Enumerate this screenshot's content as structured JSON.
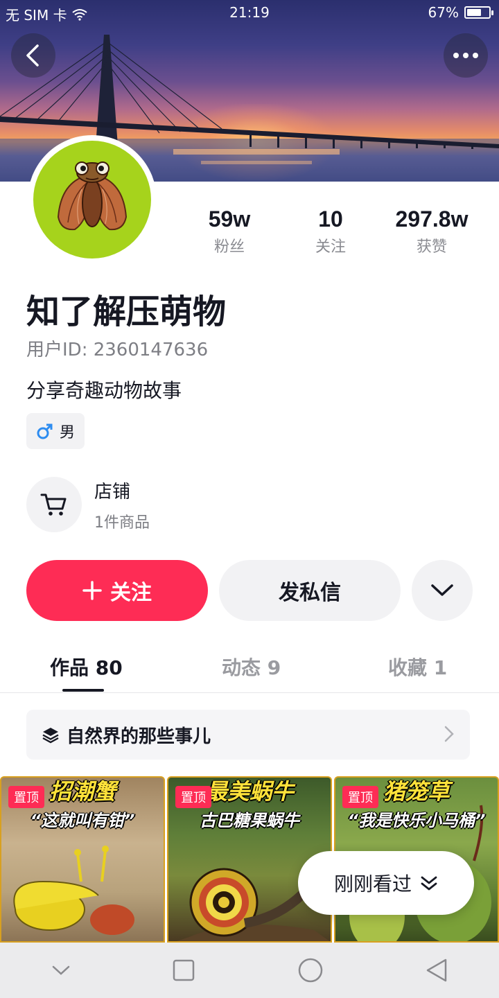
{
  "status_bar": {
    "carrier": "无 SIM 卡",
    "time": "21:19",
    "battery": "67%",
    "battery_level": 0.67
  },
  "header": {
    "back_icon": "chevron-left-icon",
    "more_icon": "more-dots-icon"
  },
  "profile": {
    "name": "知了解压萌物",
    "user_id": "用户ID: 2360147636",
    "bio": "分享奇趣动物故事",
    "gender": "男",
    "gender_icon": "male-icon"
  },
  "stats": [
    {
      "value": "59w",
      "label": "粉丝"
    },
    {
      "value": "10",
      "label": "关注"
    },
    {
      "value": "297.8w",
      "label": "获赞"
    }
  ],
  "shop": {
    "title": "店铺",
    "subtitle": "1件商品"
  },
  "actions": {
    "follow": "关注",
    "message": "发私信"
  },
  "tabs": [
    {
      "label": "作品 80",
      "active": true
    },
    {
      "label": "动态 9",
      "active": false
    },
    {
      "label": "收藏 1",
      "active": false
    }
  ],
  "collection": {
    "title": "自然界的那些事儿"
  },
  "videos": [
    {
      "badge": "置顶",
      "title": "招潮蟹",
      "subtitle": "“这就叫有钳”"
    },
    {
      "badge": "置顶",
      "title": "最美蜗牛",
      "subtitle": "古巴糖果蜗牛"
    },
    {
      "badge": "置顶",
      "title": "猪笼草",
      "subtitle": "“我是快乐小马桶”"
    }
  ],
  "recent": {
    "label": "刚刚看过"
  },
  "colors": {
    "accent": "#fe2c55",
    "text": "#161823",
    "muted": "#7d7e84",
    "chip_bg": "#f2f2f4"
  }
}
